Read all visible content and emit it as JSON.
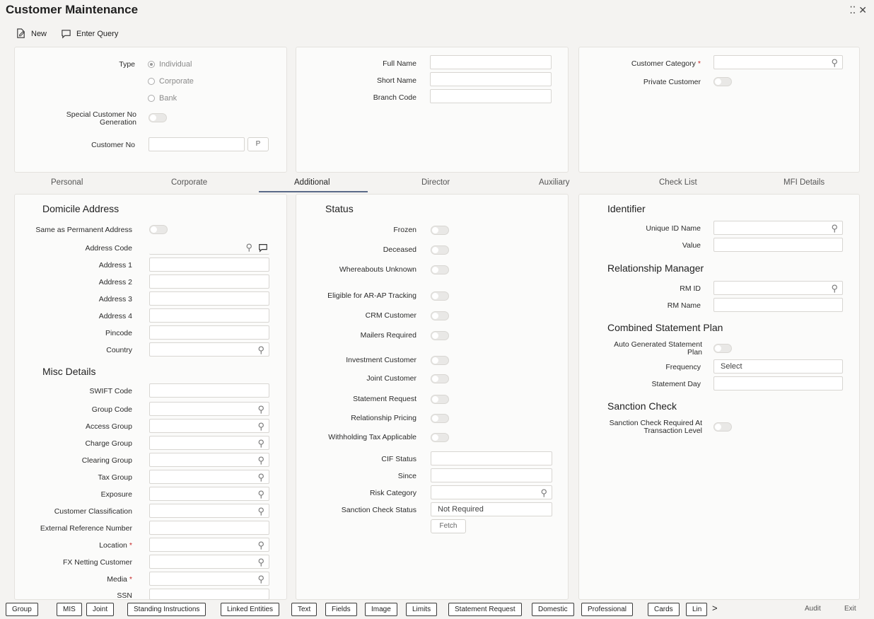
{
  "window": {
    "title": "Customer Maintenance",
    "restore_glyph": "⁚⁚",
    "close_glyph": "✕"
  },
  "toolbar": {
    "new_label": "New",
    "enter_query_label": "Enter Query"
  },
  "header": {
    "type_label": "Type",
    "type_options": [
      "Individual",
      "Corporate",
      "Bank"
    ],
    "type_selected": "Individual",
    "special_customer_label": "Special Customer No Generation",
    "customer_no_label": "Customer No",
    "customer_no_value": "",
    "customer_no_button": "P",
    "full_name_label": "Full Name",
    "short_name_label": "Short Name",
    "branch_code_label": "Branch Code",
    "customer_category_label": "Customer Category",
    "private_customer_label": "Private Customer"
  },
  "tabs": [
    "Personal",
    "Corporate",
    "Additional",
    "Director",
    "Auxiliary",
    "Check List",
    "MFI Details"
  ],
  "active_tab": "Additional",
  "domicile": {
    "heading": "Domicile Address",
    "same_as_permanent_label": "Same as Permanent Address",
    "address_code_label": "Address Code",
    "address1_label": "Address 1",
    "address2_label": "Address 2",
    "address3_label": "Address 3",
    "address4_label": "Address 4",
    "pincode_label": "Pincode",
    "country_label": "Country"
  },
  "misc": {
    "heading": "Misc Details",
    "swift_code_label": "SWIFT Code",
    "group_code_label": "Group Code",
    "access_group_label": "Access Group",
    "charge_group_label": "Charge Group",
    "clearing_group_label": "Clearing Group",
    "tax_group_label": "Tax Group",
    "exposure_label": "Exposure",
    "customer_classification_label": "Customer Classification",
    "external_reference_label": "External Reference Number",
    "location_label": "Location",
    "fx_netting_label": "FX Netting Customer",
    "media_label": "Media",
    "ssn_label": "SSN"
  },
  "status": {
    "heading": "Status",
    "frozen_label": "Frozen",
    "deceased_label": "Deceased",
    "whereabouts_label": "Whereabouts Unknown",
    "eligible_label": "Eligible for AR-AP Tracking",
    "crm_label": "CRM Customer",
    "mailers_label": "Mailers Required",
    "investment_label": "Investment Customer",
    "joint_label": "Joint Customer",
    "statement_request_label": "Statement Request",
    "relationship_pricing_label": "Relationship Pricing",
    "withholding_label": "Withholding Tax Applicable",
    "cif_status_label": "CIF Status",
    "since_label": "Since",
    "risk_category_label": "Risk Category",
    "sanction_status_label": "Sanction Check Status",
    "sanction_status_value": "Not Required",
    "fetch_label": "Fetch"
  },
  "identifier": {
    "heading": "Identifier",
    "unique_id_label": "Unique ID Name",
    "value_label": "Value"
  },
  "rm": {
    "heading": "Relationship Manager",
    "rm_id_label": "RM ID",
    "rm_name_label": "RM Name"
  },
  "statement_plan": {
    "heading": "Combined Statement Plan",
    "auto_generated_label": "Auto Generated Statement Plan",
    "frequency_label": "Frequency",
    "frequency_value": "Select",
    "statement_day_label": "Statement Day"
  },
  "sanction": {
    "heading": "Sanction Check",
    "required_label": "Sanction Check Required At Transaction Level"
  },
  "bottom_bar": {
    "buttons": [
      "Group",
      "MIS",
      "Joint",
      "Standing Instructions",
      "Linked Entities",
      "Text",
      "Fields",
      "Image",
      "Limits",
      "Statement Request",
      "Domestic",
      "Professional",
      "Cards",
      "Lin"
    ],
    "more_glyph": ">",
    "audit_label": "Audit",
    "exit_label": "Exit"
  },
  "icons": {
    "search": "search-icon",
    "message": "message-icon"
  },
  "colors": {
    "required": "#c62828",
    "active_tab_underline": "#5a6a88",
    "background": "#f4f3f1"
  }
}
